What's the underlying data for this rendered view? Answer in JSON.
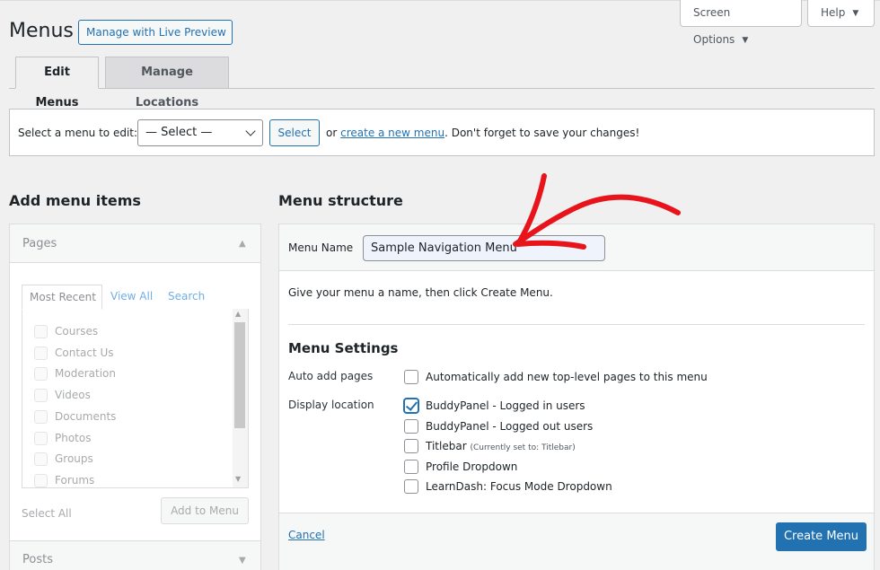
{
  "header": {
    "title": "Menus",
    "live_preview_label": "Manage with Live Preview",
    "screen_options_label": "Screen Options",
    "help_label": "Help"
  },
  "tabs": [
    {
      "label": "Edit Menus",
      "active": true
    },
    {
      "label": "Manage Locations",
      "active": false
    }
  ],
  "select_bar": {
    "label": "Select a menu to edit:",
    "select_value": "— Select —",
    "select_button": "Select",
    "or_text": "or",
    "create_link": "create a new menu",
    "tail_text": ". Don't forget to save your changes!"
  },
  "left": {
    "title": "Add menu items",
    "pages_title": "Pages",
    "inner_tabs": [
      "Most Recent",
      "View All",
      "Search"
    ],
    "page_items": [
      "Courses",
      "Contact Us",
      "Moderation",
      "Videos",
      "Documents",
      "Photos",
      "Groups",
      "Forums"
    ],
    "select_all": "Select All",
    "add_to_menu": "Add to Menu",
    "posts_title": "Posts"
  },
  "right": {
    "title": "Menu structure",
    "menu_name_label": "Menu Name",
    "menu_name_value": "Sample Navigation Menu",
    "hint": "Give your menu a name, then click Create Menu.",
    "settings_title": "Menu Settings",
    "auto_add_label": "Auto add pages",
    "auto_add_option": "Automatically add new top-level pages to this menu",
    "display_location_label": "Display location",
    "locations": [
      {
        "label": "BuddyPanel - Logged in users",
        "checked": true,
        "note": ""
      },
      {
        "label": "BuddyPanel - Logged out users",
        "checked": false,
        "note": ""
      },
      {
        "label": "Titlebar",
        "checked": false,
        "note": "(Currently set to: Titlebar)"
      },
      {
        "label": "Profile Dropdown",
        "checked": false,
        "note": ""
      },
      {
        "label": "LearnDash: Focus Mode Dropdown",
        "checked": false,
        "note": ""
      }
    ],
    "cancel": "Cancel",
    "create_button": "Create Menu"
  },
  "colors": {
    "accent": "#2271b1",
    "annotation_arrow": "#e8141c",
    "background": "#f0f0f1"
  }
}
